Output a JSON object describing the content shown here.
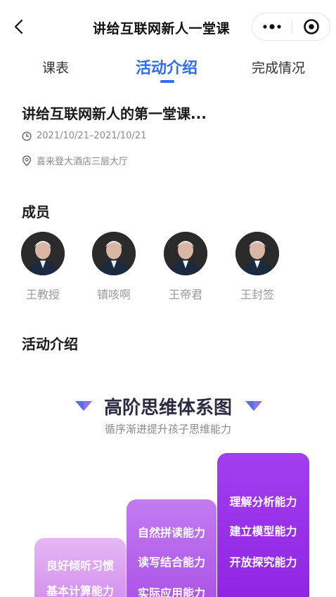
{
  "navbar": {
    "title": "讲给互联网新人一堂课",
    "back_icon": "chevron-left-icon",
    "more_icon": "more-dots-icon",
    "target_icon": "target-circle-icon"
  },
  "tabs": [
    {
      "label": "课表",
      "active": false
    },
    {
      "label": "活动介绍",
      "active": true
    },
    {
      "label": "完成情况",
      "active": false
    }
  ],
  "event": {
    "title": "讲给互联网新人的第一堂课...",
    "date": "2021/10/21–2021/10/21",
    "location": "喜来登大酒店三层大厅"
  },
  "sections": {
    "members_title": "成员",
    "intro_title": "活动介绍"
  },
  "members": [
    {
      "name": "王教授"
    },
    {
      "name": "镇咳啊"
    },
    {
      "name": "王帝君"
    },
    {
      "name": "王封签"
    }
  ],
  "banner": {
    "title": "高阶思维体系图",
    "subtitle": "循序渐进提升孩子思维能力",
    "columns": [
      {
        "skills": [
          "良好倾听习惯",
          "基本计算能力"
        ]
      },
      {
        "skills": [
          "自然拼读能力",
          "读写结合能力",
          "实际应用能力"
        ]
      },
      {
        "skills": [
          "理解分析能力",
          "建立模型能力",
          "开放探究能力"
        ]
      }
    ]
  },
  "colors": {
    "accent": "#2f6bff",
    "column_light": "#dc9ff0",
    "column_mid": "#b765ea",
    "column_dark": "#9630e8"
  }
}
